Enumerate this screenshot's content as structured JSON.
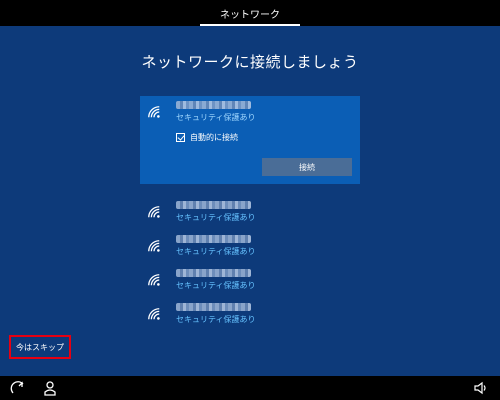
{
  "header": {
    "tab_label": "ネットワーク"
  },
  "main": {
    "title": "ネットワークに接続しましょう",
    "networks": [
      {
        "name": "■■■■■■",
        "security": "セキュリティ保護あり",
        "selected": true
      },
      {
        "name": "■■■■■■",
        "security": "セキュリティ保護あり"
      },
      {
        "name": "■■■■■■",
        "security": "セキュリティ保護あり"
      },
      {
        "name": "■■■■■■",
        "security": "セキュリティ保護あり"
      },
      {
        "name": "■■■■■■",
        "security": "セキュリティ保護あり"
      }
    ],
    "auto_connect_label": "自動的に接続",
    "auto_connect_checked": true,
    "connect_label": "接続"
  },
  "skip": {
    "label": "今はスキップ"
  },
  "bottombar": {
    "icons": [
      "ease-of-access-icon",
      "narrator-icon",
      "volume-icon"
    ]
  },
  "colors": {
    "background": "#0d3a7a",
    "selected": "#0b5eb5",
    "security_text": "#66c2ff",
    "highlight_border": "#e60012"
  }
}
